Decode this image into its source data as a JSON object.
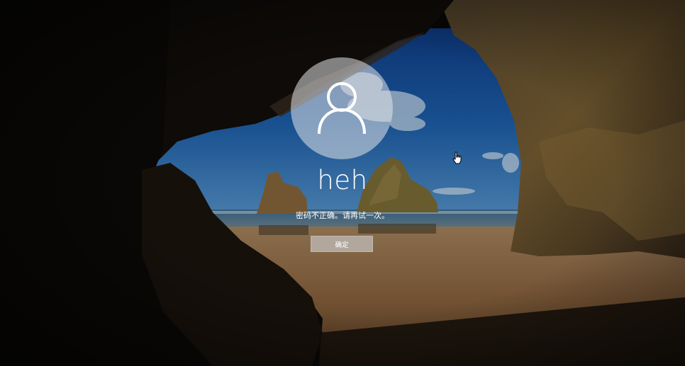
{
  "lock_screen": {
    "user": {
      "name": "heh",
      "avatar_icon": "user-silhouette-icon"
    },
    "message": "密码不正确。请再试一次。",
    "ok_button_label": "确定",
    "cursor_icon": "hand-pointer-icon",
    "colors": {
      "avatar_bg": "#d8dbe0",
      "button_bg": "#b2a79d",
      "text": "#ffffff",
      "sky": "#1f5eaa",
      "sand": "#9a6e45",
      "rock": "#6e5632"
    }
  }
}
